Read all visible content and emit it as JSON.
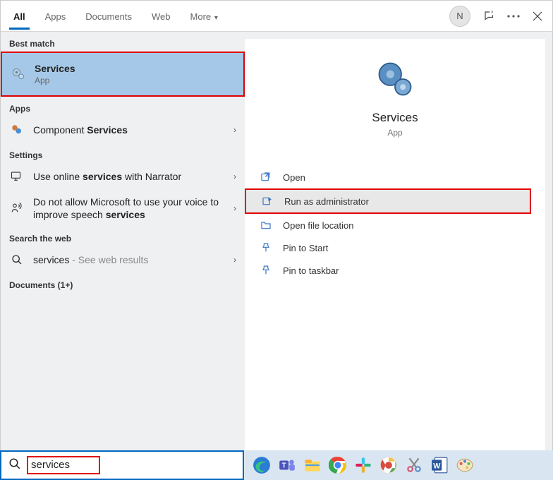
{
  "tabs": {
    "all": "All",
    "apps": "Apps",
    "documents": "Documents",
    "web": "Web",
    "more": "More"
  },
  "user_initial": "N",
  "sections": {
    "best_match": "Best match",
    "apps": "Apps",
    "settings": "Settings",
    "search_web": "Search the web",
    "documents": "Documents (1+)"
  },
  "best_match": {
    "title": "Services",
    "subtitle": "App"
  },
  "results": {
    "component_prefix": "Component ",
    "component_bold": "Services",
    "setting1_pre": "Use online ",
    "setting1_bold": "services",
    "setting1_post": " with Narrator",
    "setting2_pre": "Do not allow Microsoft to use your voice to improve speech ",
    "setting2_bold": "services",
    "web_query": "services",
    "web_suffix": " - See web results"
  },
  "detail": {
    "title": "Services",
    "subtitle": "App"
  },
  "actions": {
    "open": "Open",
    "run_admin": "Run as administrator",
    "open_location": "Open file location",
    "pin_start": "Pin to Start",
    "pin_taskbar": "Pin to taskbar"
  },
  "search": {
    "value": "services"
  }
}
